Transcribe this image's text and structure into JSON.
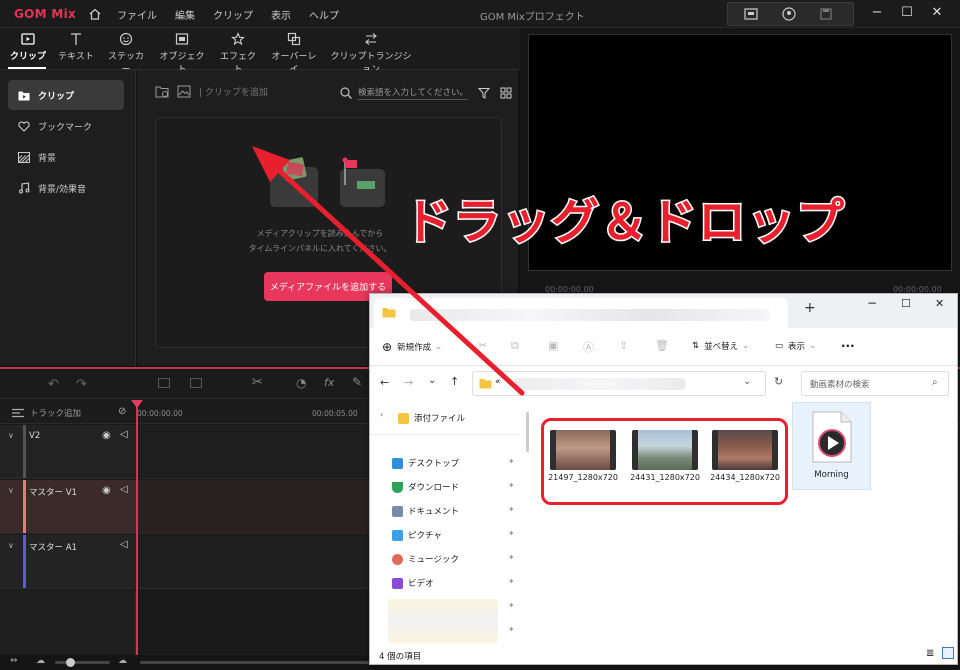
{
  "app": {
    "logo": "GOM Mix",
    "window_title": "GOM Mixプロフェクト",
    "menu": [
      "ファイル",
      "編集",
      "クリップ",
      "表示",
      "ヘルプ"
    ]
  },
  "tabs": [
    {
      "label": "クリップ",
      "active": true
    },
    {
      "label": "テキスト"
    },
    {
      "label": "ステッカー"
    },
    {
      "label": "オブジェクト"
    },
    {
      "label": "エフェクト"
    },
    {
      "label": "オーバーレイ"
    },
    {
      "label": "クリップトランジション"
    }
  ],
  "sidebar": {
    "items": [
      {
        "label": "クリップ",
        "icon": "clip-folder-icon",
        "active": true
      },
      {
        "label": "ブックマーク",
        "icon": "heart-icon"
      },
      {
        "label": "背景",
        "icon": "background-icon"
      },
      {
        "label": "背景/効果音",
        "icon": "music-note-icon"
      }
    ]
  },
  "media": {
    "add_clip_label": "クリップを追加",
    "search_placeholder": "検索語を入力してください。",
    "drop_text_line1": "メディアクリップを読み込んでから",
    "drop_text_line2": "タイムラインパネルに入れてください。",
    "add_button": "メディアファイルを追加する"
  },
  "preview": {
    "timecode_left": "00:00:00.00",
    "timecode_right": "00:00:00.00"
  },
  "timeline": {
    "track_add": "トラック追加",
    "ruler": [
      "00:00:00.00",
      "00:00:05.00"
    ],
    "tracks": [
      {
        "name": "V2",
        "color": "#8a8a8a"
      },
      {
        "name": "マスター V1",
        "color": "#e57a7a"
      },
      {
        "name": "マスター A1",
        "color": "#5b5bd6"
      }
    ]
  },
  "annotation": {
    "text": "ドラッグ＆ドロップ",
    "color": "#e8202e"
  },
  "explorer": {
    "new_tab_symbol": "+",
    "toolbar": {
      "new_label": "新規作成",
      "sort_label": "並べ替え",
      "view_label": "表示",
      "more_label": "..."
    },
    "address_prefix": "«",
    "search_placeholder": "動画素材の検索",
    "nav": [
      {
        "label": "添付ファイル",
        "icon": "folder-icon"
      },
      {
        "label": "デスクトップ",
        "icon": "desktop-icon"
      },
      {
        "label": "ダウンロード",
        "icon": "download-icon"
      },
      {
        "label": "ドキュメント",
        "icon": "document-icon"
      },
      {
        "label": "ピクチャ",
        "icon": "picture-icon"
      },
      {
        "label": "ミュージック",
        "icon": "music-icon"
      },
      {
        "label": "ビデオ",
        "icon": "video-icon"
      }
    ],
    "files": [
      {
        "name": "21497_1280x720",
        "type": "video"
      },
      {
        "name": "24431_1280x720",
        "type": "video"
      },
      {
        "name": "24434_1280x720",
        "type": "video"
      },
      {
        "name": "Morning",
        "type": "audio"
      }
    ],
    "status": "4 個の項目"
  }
}
